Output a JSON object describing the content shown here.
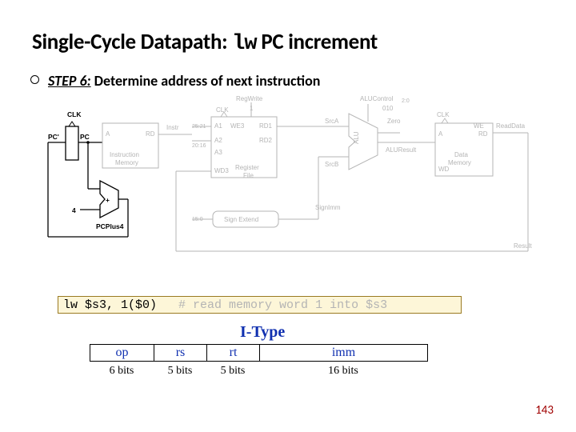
{
  "title_prefix": "Single-Cycle Datapath: ",
  "title_mono": "lw",
  "title_suffix": " PC increment",
  "step_label": "STEP 6:",
  "step_text": " Determine address of next instruction",
  "diagram": {
    "clk1": "CLK",
    "pcprime": "PC'",
    "pc": "PC",
    "instr_mem": "Instruction\nMemory",
    "a": "A",
    "rd": "RD",
    "instr": "Instr",
    "bits2521": "25:21",
    "bits2016": "20:16",
    "bits150": "15:0",
    "regfile": "Register\nFile",
    "a1": "A1",
    "a2": "A2",
    "a3": "A3",
    "we3": "WE3",
    "wd3": "WD3",
    "rd1": "RD1",
    "rd2": "RD2",
    "regwrite": "RegWrite",
    "one": "1",
    "clk2": "CLK",
    "signext": "Sign Extend",
    "signimm": "SignImm",
    "srca": "SrcA",
    "srcb": "SrcB",
    "alu": "ALU",
    "alucontrol": "ALUControl",
    "alucontrol_sub": "2:0",
    "alucontrol_val": "010",
    "zero": "Zero",
    "aluresult": "ALUResult",
    "clk3": "CLK",
    "datamem": "Data\nMemory",
    "a_dm": "A",
    "rd_dm": "RD",
    "wd_dm": "WD",
    "we_dm": "WE",
    "readdata": "ReadData",
    "result": "Result",
    "four": "4",
    "pcplus4": "PCPlus4"
  },
  "code_instr": "lw $s3, 1($0)",
  "code_comment": "   # read memory word 1 into $s3",
  "itype_label": "I-Type",
  "itype_headers": [
    "op",
    "rs",
    "rt",
    "imm"
  ],
  "itype_bits": [
    "6 bits",
    "5 bits",
    "5 bits",
    "16 bits"
  ],
  "page": "143"
}
